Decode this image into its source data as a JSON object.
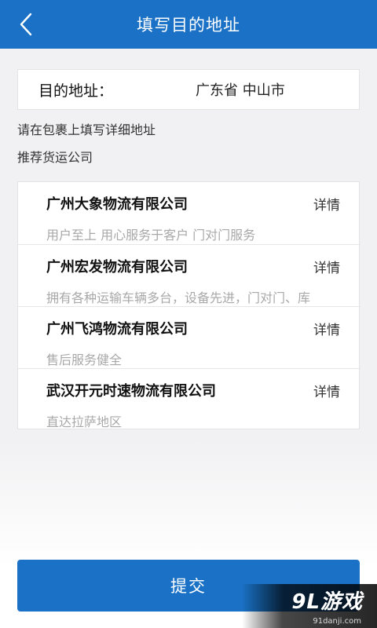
{
  "header": {
    "title": "填写目的地址",
    "back_icon": "chevron-left-icon"
  },
  "destination": {
    "label": "目的地址：",
    "value": "广东省 中山市"
  },
  "hints": {
    "fill_detail": "请在包裹上填写详细地址",
    "recommend": "推荐货运公司"
  },
  "companies": [
    {
      "name": "广州大象物流有限公司",
      "detail": "详情",
      "desc": "用户至上 用心服务于客户 门对门服务"
    },
    {
      "name": "广州宏发物流有限公司",
      "detail": "详情",
      "desc": "拥有各种运输车辆多台，设备先进，门对门、库"
    },
    {
      "name": "广州飞鸿物流有限公司",
      "detail": "详情",
      "desc": "售后服务健全"
    },
    {
      "name": "武汉开元时速物流有限公司",
      "detail": "详情",
      "desc": "直达拉萨地区"
    }
  ],
  "submit": {
    "label": "提交"
  },
  "watermark": {
    "logo": "9L游戏",
    "url": "91danji.com"
  },
  "colors": {
    "primary": "#1a71c5",
    "background": "#f1f1f3",
    "muted_text": "#a8a8a8"
  }
}
